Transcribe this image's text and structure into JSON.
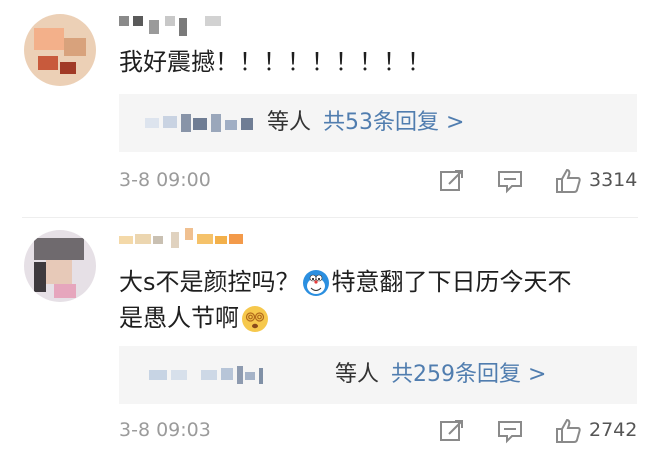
{
  "comments": [
    {
      "text": "我好震撼！！！！！！！！！",
      "reply_deng": "等人",
      "reply_total": "共53条回复 >",
      "time": "3-8 09:00",
      "likes": "3314"
    },
    {
      "text_part1": "大s不是颜控吗？",
      "text_part2": "特意翻了下日历今天不",
      "text_part3": "是愚人节啊",
      "reply_deng": "等人",
      "reply_total": "共259条回复 >",
      "time": "3-8 09:03",
      "likes": "2742"
    }
  ],
  "icons": [
    "share-icon",
    "comment-icon",
    "thumbs-up-icon",
    "doraemon-emoji",
    "dizzy-face-emoji"
  ],
  "colors": {
    "link": "#507daf",
    "reply_bg": "#f5f5f5",
    "meta": "#9b9b9b"
  }
}
